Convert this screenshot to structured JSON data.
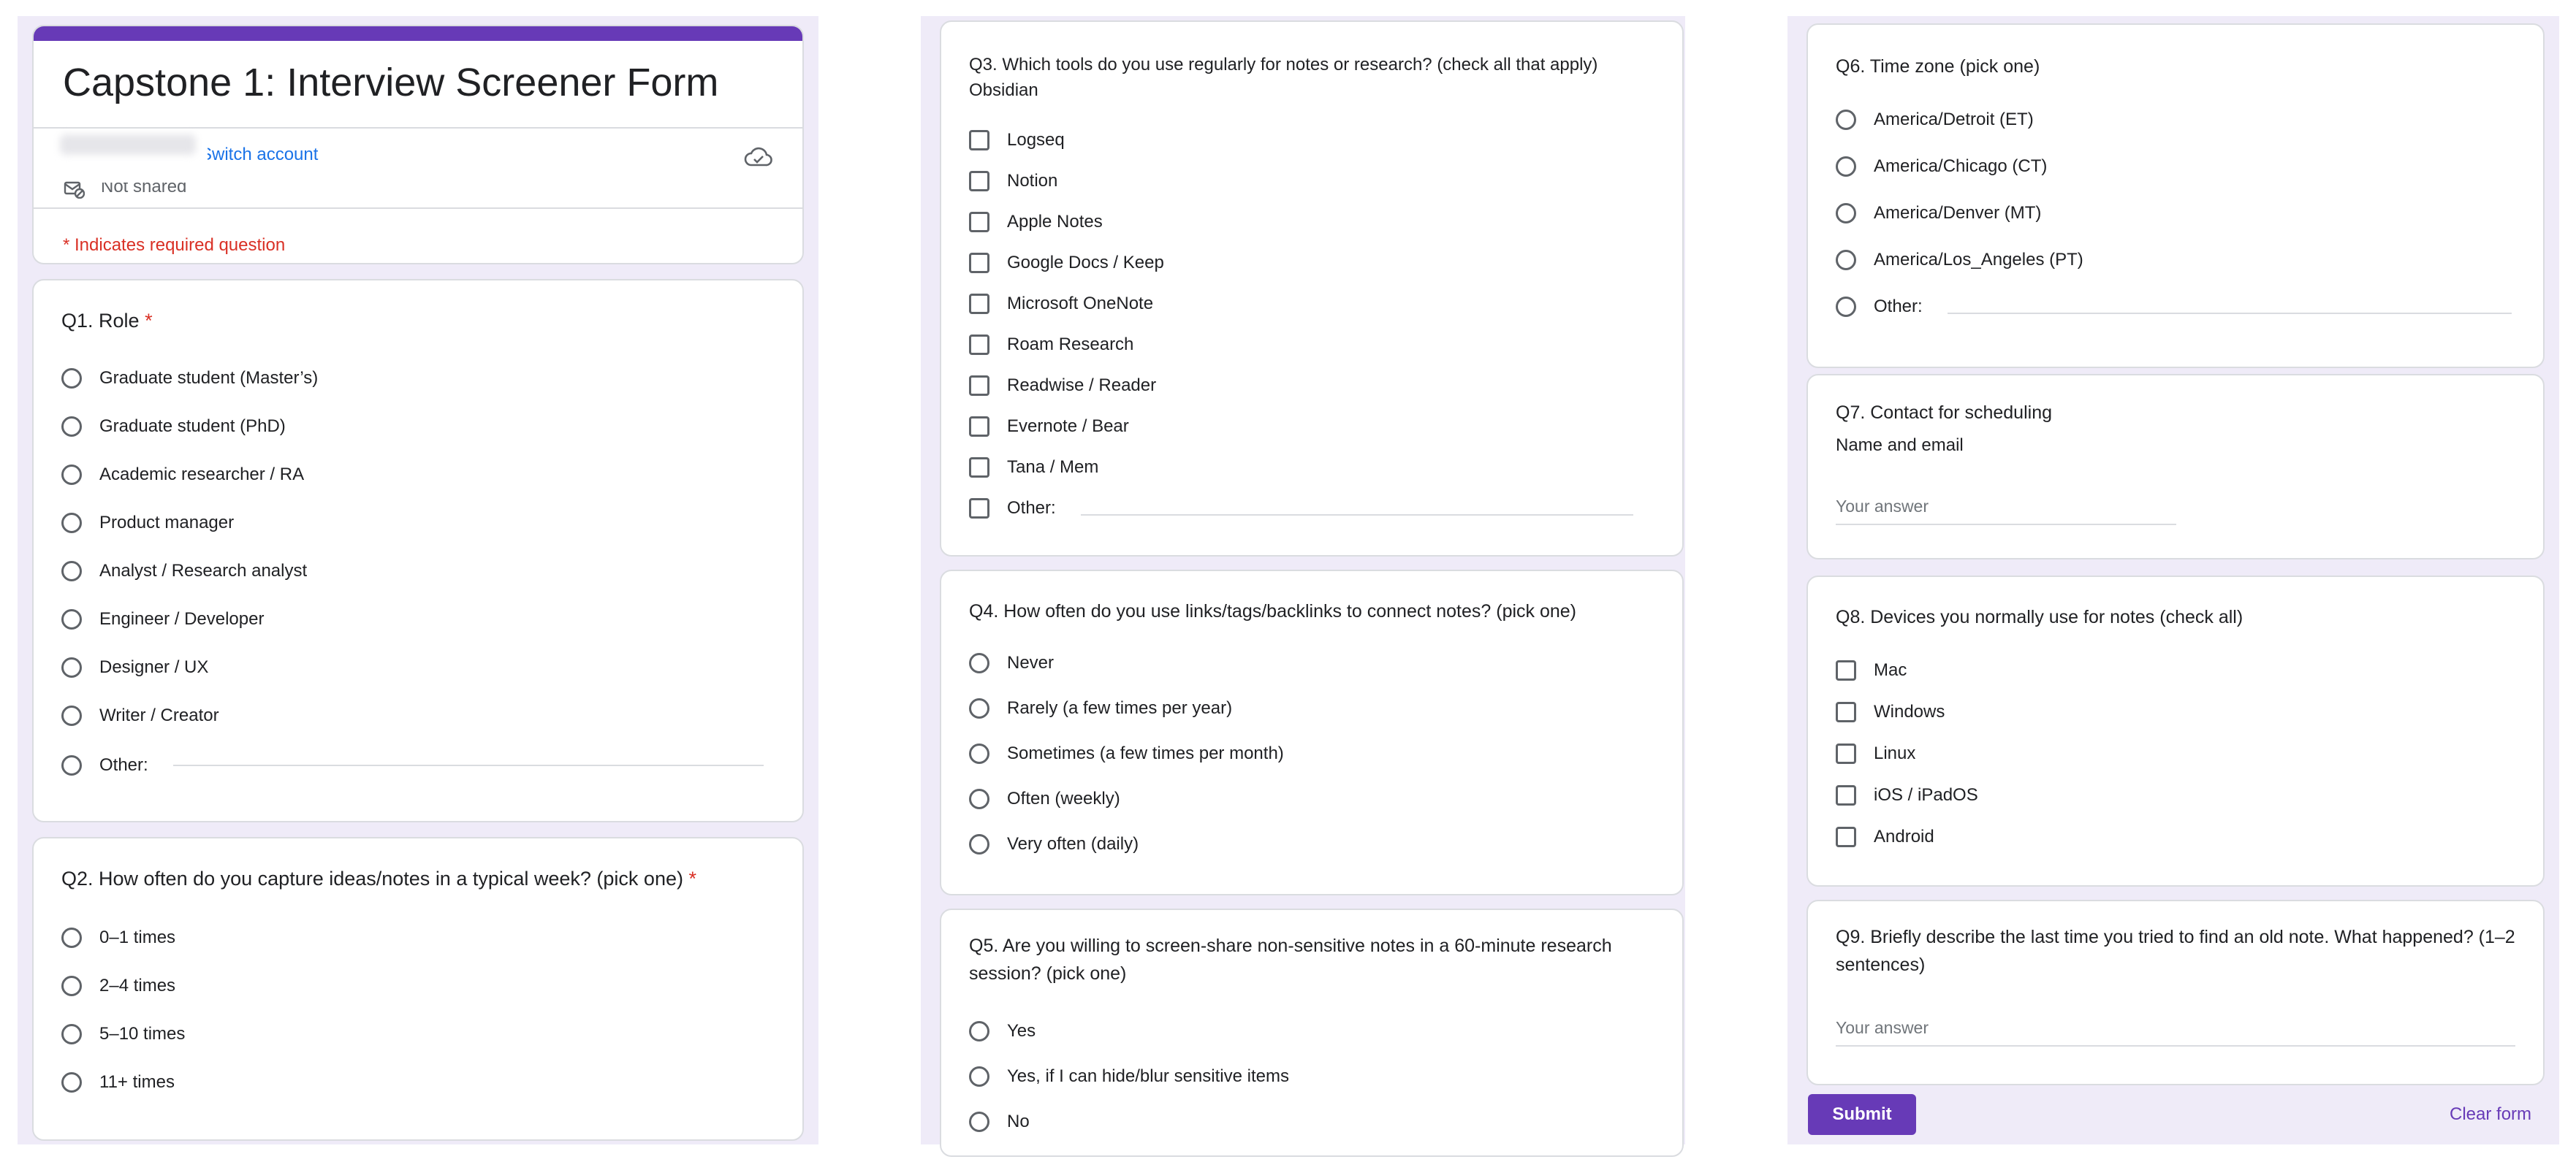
{
  "header": {
    "title": "Capstone 1: Interview Screener Form",
    "switch_account": "Switch account",
    "not_shared": "Not shared",
    "required_note": "* Indicates required question"
  },
  "q1": {
    "title": "Q1. Role",
    "required_mark": "*",
    "options": [
      "Graduate student (Master’s)",
      "Graduate student (PhD)",
      "Academic researcher / RA",
      "Product manager",
      "Analyst / Research analyst",
      "Engineer / Developer",
      "Designer / UX",
      "Writer / Creator"
    ],
    "other_label": "Other:"
  },
  "q2": {
    "title": "Q2. How often do you capture ideas/notes in a typical week? (pick one)",
    "required_mark": "*",
    "options": [
      "0–1 times",
      "2–4 times",
      "5–10 times",
      "11+ times"
    ]
  },
  "q3": {
    "title": "Q3. Which tools do you use regularly for notes or research? (check all that apply)",
    "subtitle": "Obsidian",
    "options": [
      "Logseq",
      "Notion",
      "Apple Notes",
      "Google Docs / Keep",
      "Microsoft OneNote",
      "Roam Research",
      "Readwise / Reader",
      "Evernote / Bear",
      "Tana / Mem"
    ],
    "other_label": "Other:"
  },
  "q4": {
    "title": "Q4. How often do you use links/tags/backlinks to connect notes? (pick one)",
    "options": [
      "Never",
      "Rarely (a few times per year)",
      "Sometimes (a few times per month)",
      "Often (weekly)",
      "Very often (daily)"
    ]
  },
  "q5": {
    "title": "Q5. Are you willing to screen-share non-sensitive notes in a 60-minute research session? (pick one)",
    "options": [
      "Yes",
      "Yes, if I can hide/blur sensitive items",
      "No"
    ]
  },
  "q6": {
    "title": "Q6. Time zone (pick one)",
    "options": [
      "America/Detroit (ET)",
      "America/Chicago (CT)",
      "America/Denver (MT)",
      "America/Los_Angeles (PT)"
    ],
    "other_label": "Other:"
  },
  "q7": {
    "title": "Q7. Contact for scheduling",
    "subtitle": "Name and email",
    "placeholder": "Your answer"
  },
  "q8": {
    "title": "Q8. Devices you normally use for notes (check all)",
    "options": [
      "Mac",
      "Windows",
      "Linux",
      "iOS / iPadOS",
      "Android"
    ]
  },
  "q9": {
    "title": "Q9. Briefly describe the last time you tried to find an old note. What happened? (1–2 sentences)",
    "placeholder": "Your answer"
  },
  "footer": {
    "submit": "Submit",
    "clear": "Clear form"
  },
  "colors": {
    "accent": "#673ab7",
    "background": "#efebf8",
    "required": "#d93025",
    "link": "#1a73e8"
  },
  "icons": {
    "cloud": "cloud-save-icon",
    "not_shared": "not-shared-icon"
  }
}
